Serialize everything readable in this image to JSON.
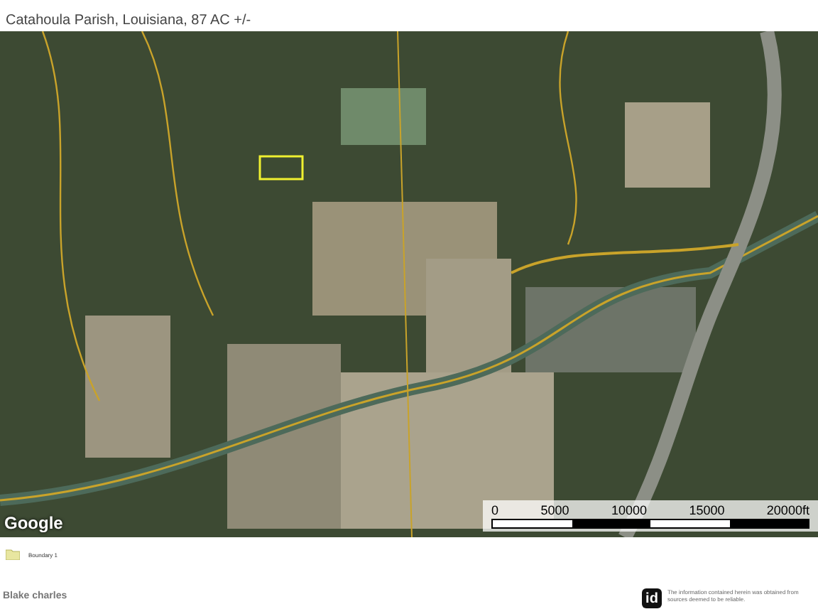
{
  "header": {
    "subtitle": "Catahoula Parish, Louisiana, 87 AC +/-"
  },
  "map": {
    "attribution": "Google",
    "scale_bar": {
      "labels": [
        "0",
        "5000",
        "10000",
        "15000",
        "20000ft"
      ]
    }
  },
  "legend": [
    {
      "label": "Boundary 1"
    }
  ],
  "agent": {
    "name": "Blake charles"
  },
  "disclaimer": {
    "logo": "id",
    "text": "The information contained herein was obtained from sources deemed to be reliable."
  }
}
